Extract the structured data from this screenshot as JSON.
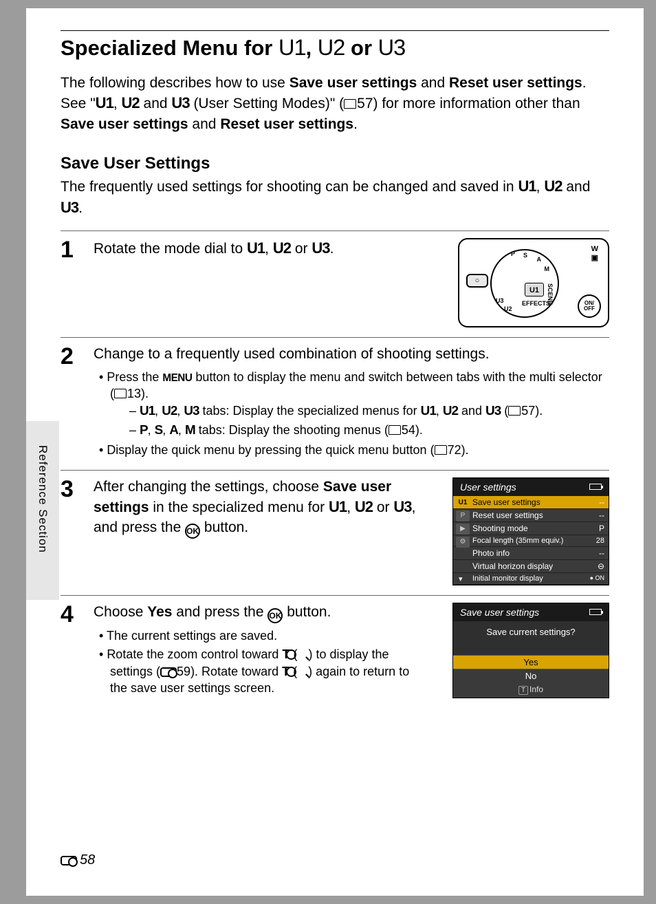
{
  "side_label": "Reference Section",
  "title_pre": "Specialized Menu for ",
  "title_u1": "U1",
  "title_mid": ", ",
  "title_u2": "U2",
  "title_or": " or ",
  "title_u3": "U3",
  "intro": {
    "t1": "The following describes how to use ",
    "b1": "Save user settings",
    "t2": " and ",
    "b2": "Reset user settings",
    "t3": ". See \"",
    "u1": "U1",
    "t4": ", ",
    "u2": "U2",
    "t5": " and ",
    "u3": "U3",
    "t6": " (User Setting Modes)\" (",
    "ref": "57",
    "t7": ") for more information other than ",
    "b3": "Save user settings",
    "t8": " and ",
    "b4": "Reset user settings",
    "t9": "."
  },
  "section_title": "Save User Settings",
  "section_intro": {
    "t1": "The frequently used settings for shooting can be changed and saved in ",
    "u1": "U1",
    "t2": ", ",
    "u2": "U2",
    "t3": " and ",
    "u3": "U3",
    "t4": "."
  },
  "steps": {
    "s1": {
      "num": "1",
      "text_pre": "Rotate the mode dial to ",
      "u1": "U1",
      "c1": ", ",
      "u2": "U2",
      "c2": " or ",
      "u3": "U3",
      "text_post": "."
    },
    "dial": {
      "center": "U1",
      "indicator": "",
      "labels": {
        "effects": "EFFECTS",
        "scene": "SCENE",
        "u2": "U2",
        "u3": "U3",
        "p": "P",
        "s": "S",
        "a": "A",
        "m": "M"
      },
      "onoff": "ON/\nOFF",
      "w": "W"
    },
    "s2": {
      "num": "2",
      "title": "Change to a frequently used combination of shooting settings.",
      "b1a": "Press the ",
      "b1menu": "MENU",
      "b1b": " button to display the menu and switch between tabs with the multi selector (",
      "b1ref": "13",
      "b1c": ").",
      "sub1a": "U1",
      "sub1b": "U2",
      "sub1c": "U3",
      "sub1txt1": ", ",
      "sub1txt2": ", ",
      "sub1d": " tabs: Display the specialized menus for ",
      "sub1e": "U1",
      "sub1f": "U2",
      "sub1g": "U3",
      "sub1txt3": ", ",
      "sub1txt4": " and ",
      "sub1h": " (",
      "sub1ref": "57",
      "sub1i": ").",
      "sub2a": "P",
      "sub2b": "S",
      "sub2c": "A",
      "sub2d": "M",
      "sub2txt1": ", ",
      "sub2txt2": ", ",
      "sub2txt3": ", ",
      "sub2e": " tabs: Display the shooting menus (",
      "sub2ref": "54",
      "sub2f": ").",
      "b2a": "Display the quick menu by pressing the quick menu button (",
      "b2ref": "72",
      "b2b": ")."
    },
    "s3": {
      "num": "3",
      "t1": "After changing the settings, choose ",
      "b1": "Save user settings",
      "t2": " in the specialized menu for ",
      "u1": "U1",
      "c1": ", ",
      "u2": "U2",
      "c2": " or ",
      "u3": "U3",
      "t3": ", and press the ",
      "ok": "k",
      "t4": " button."
    },
    "lcd1": {
      "title": "User settings",
      "tabs": [
        "U1",
        "P",
        "",
        ""
      ],
      "rows": [
        {
          "label": "Save user settings",
          "val": "--"
        },
        {
          "label": "Reset user settings",
          "val": "--"
        },
        {
          "label": "Shooting mode",
          "val": "P"
        },
        {
          "label": "Focal length (35mm equiv.)",
          "val": "28"
        },
        {
          "label": "Photo info",
          "val": "--"
        },
        {
          "label": "Virtual horizon display",
          "val": "⊖"
        },
        {
          "label": "Initial monitor display",
          "val": "● ON"
        }
      ]
    },
    "s4": {
      "num": "4",
      "t1": "Choose ",
      "b1": "Yes",
      "t2": " and press the ",
      "t3": " button.",
      "bul1": "The current settings are saved.",
      "bul2a": "Rotate the zoom control toward ",
      "bul2t1": "T",
      "bul2b": " (",
      "bul2c": ") to display the settings (",
      "bul2ref": "59",
      "bul2d": "). Rotate toward ",
      "bul2t2": "T",
      "bul2e": " (",
      "bul2f": ") again to return to the save user settings screen."
    },
    "lcd2": {
      "title": "Save user settings",
      "prompt": "Save current settings?",
      "yes": "Yes",
      "no": "No",
      "info": "Info"
    }
  },
  "page_number": "58"
}
